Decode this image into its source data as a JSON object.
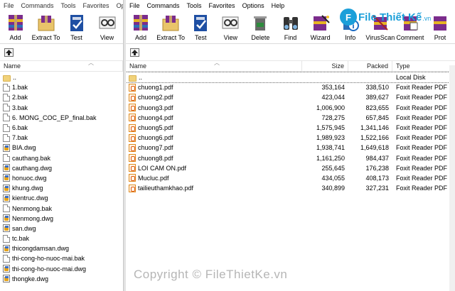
{
  "left": {
    "menu": [
      "File",
      "Commands",
      "Tools",
      "Favorites",
      "Op"
    ],
    "toolbar": [
      {
        "label": "Add",
        "icon": "add-archive-icon"
      },
      {
        "label": "Extract To",
        "icon": "extract-to-icon"
      },
      {
        "label": "Test",
        "icon": "test-icon"
      },
      {
        "label": "View",
        "icon": "view-icon"
      }
    ],
    "columns": {
      "name": "Name"
    },
    "files": [
      {
        "name": "..",
        "type": "folder"
      },
      {
        "name": "1.bak",
        "type": "doc"
      },
      {
        "name": "2.bak",
        "type": "doc"
      },
      {
        "name": "3.bak",
        "type": "doc"
      },
      {
        "name": "6. MONG_COC_EP_final.bak",
        "type": "doc"
      },
      {
        "name": "6.bak",
        "type": "doc"
      },
      {
        "name": "7.bak",
        "type": "doc"
      },
      {
        "name": "BIA.dwg",
        "type": "dwg"
      },
      {
        "name": "cauthang.bak",
        "type": "doc"
      },
      {
        "name": "cauthang.dwg",
        "type": "dwg"
      },
      {
        "name": "honuoc.dwg",
        "type": "dwg"
      },
      {
        "name": "khung.dwg",
        "type": "dwg"
      },
      {
        "name": "kientruc.dwg",
        "type": "dwg"
      },
      {
        "name": "Nenmong.bak",
        "type": "doc"
      },
      {
        "name": "Nenmong.dwg",
        "type": "dwg"
      },
      {
        "name": "san.dwg",
        "type": "dwg"
      },
      {
        "name": "tc.bak",
        "type": "doc"
      },
      {
        "name": "thicongdamsan.dwg",
        "type": "dwg"
      },
      {
        "name": "thi-cong-ho-nuoc-mai.bak",
        "type": "doc"
      },
      {
        "name": "thi-cong-ho-nuoc-mai.dwg",
        "type": "dwg"
      },
      {
        "name": "thongke.dwg",
        "type": "dwg"
      }
    ]
  },
  "right": {
    "menu": [
      "File",
      "Commands",
      "Tools",
      "Favorites",
      "Options",
      "Help"
    ],
    "toolbar": [
      {
        "label": "Add",
        "icon": "add-archive-icon"
      },
      {
        "label": "Extract To",
        "icon": "extract-to-icon"
      },
      {
        "label": "Test",
        "icon": "test-icon"
      },
      {
        "label": "View",
        "icon": "view-icon"
      },
      {
        "label": "Delete",
        "icon": "delete-icon"
      },
      {
        "label": "Find",
        "icon": "find-icon"
      },
      {
        "label": "Wizard",
        "icon": "wizard-icon"
      },
      {
        "label": "Info",
        "icon": "info-icon"
      },
      {
        "label": "VirusScan",
        "icon": "virusscan-icon"
      },
      {
        "label": "Comment",
        "icon": "comment-icon"
      },
      {
        "label": "Prot",
        "icon": "protect-icon"
      }
    ],
    "columns": {
      "name": "Name",
      "size": "Size",
      "packed": "Packed",
      "type": "Type"
    },
    "files": [
      {
        "name": "..",
        "size": "",
        "packed": "",
        "ftype": "Local Disk",
        "type": "folder"
      },
      {
        "name": "chuong1.pdf",
        "size": "353,164",
        "packed": "338,510",
        "ftype": "Foxit Reader PDF D...",
        "type": "pdf"
      },
      {
        "name": "chuong2.pdf",
        "size": "423,044",
        "packed": "389,627",
        "ftype": "Foxit Reader PDF D...",
        "type": "pdf"
      },
      {
        "name": "chuong3.pdf",
        "size": "1,006,900",
        "packed": "823,655",
        "ftype": "Foxit Reader PDF D...",
        "type": "pdf"
      },
      {
        "name": "chuong4.pdf",
        "size": "728,275",
        "packed": "657,845",
        "ftype": "Foxit Reader PDF D...",
        "type": "pdf"
      },
      {
        "name": "chuong5.pdf",
        "size": "1,575,945",
        "packed": "1,341,146",
        "ftype": "Foxit Reader PDF D...",
        "type": "pdf"
      },
      {
        "name": "chuong6.pdf",
        "size": "1,989,923",
        "packed": "1,522,166",
        "ftype": "Foxit Reader PDF D...",
        "type": "pdf"
      },
      {
        "name": "chuong7.pdf",
        "size": "1,938,741",
        "packed": "1,649,618",
        "ftype": "Foxit Reader PDF D...",
        "type": "pdf"
      },
      {
        "name": "chuong8.pdf",
        "size": "1,161,250",
        "packed": "984,437",
        "ftype": "Foxit Reader PDF D...",
        "type": "pdf"
      },
      {
        "name": "LOI CAM ON.pdf",
        "size": "255,645",
        "packed": "176,238",
        "ftype": "Foxit Reader PDF D...",
        "type": "pdf"
      },
      {
        "name": "Mucluc.pdf",
        "size": "434,055",
        "packed": "408,173",
        "ftype": "Foxit Reader PDF D...",
        "type": "pdf"
      },
      {
        "name": "tailieuthamkhao.pdf",
        "size": "340,899",
        "packed": "327,231",
        "ftype": "Foxit Reader PDF D...",
        "type": "pdf"
      }
    ]
  },
  "watermark": "Copyright © FileThietKe.vn",
  "logo": {
    "mark": "F",
    "text": "File Thiết Kế",
    "suffix": ".vn"
  },
  "colors": {
    "accent": "#1b9fd9",
    "folder": "#f1d27a",
    "pdf": "#e08a1f",
    "header_line": "#e5e5e5"
  }
}
